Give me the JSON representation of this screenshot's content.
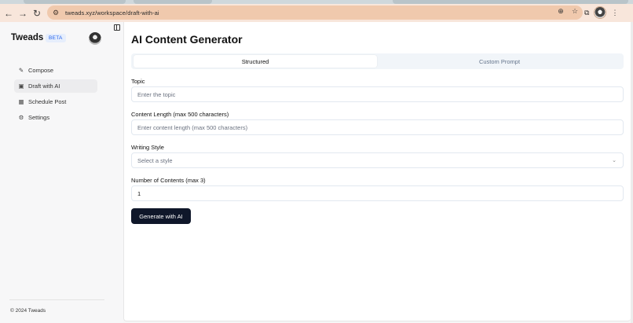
{
  "browser": {
    "url": "tweads.xyz/workspace/draft-with-ai",
    "back_icon": "arrow-left-icon",
    "forward_icon": "arrow-right-icon",
    "reload_icon": "reload-icon"
  },
  "sidebar": {
    "brand": "Tweads",
    "badge": "BETA",
    "items": [
      {
        "label": "Compose",
        "icon": "pencil-icon"
      },
      {
        "label": "Draft with AI",
        "icon": "bot-icon"
      },
      {
        "label": "Schedule Post",
        "icon": "calendar-icon"
      },
      {
        "label": "Settings",
        "icon": "gear-icon"
      }
    ],
    "active_index": 1,
    "footer": "© 2024 Tweads"
  },
  "main": {
    "title": "AI Content Generator",
    "tabs": [
      {
        "label": "Structured",
        "active": true
      },
      {
        "label": "Custom Prompt",
        "active": false
      }
    ],
    "fields": {
      "topic": {
        "label": "Topic",
        "placeholder": "Enter the topic",
        "value": ""
      },
      "length": {
        "label": "Content Length (max 500 characters)",
        "placeholder": "Enter content length (max 500 characters)",
        "value": ""
      },
      "style": {
        "label": "Writing Style",
        "placeholder": "Select a style",
        "value": ""
      },
      "count": {
        "label": "Number of Contents (max 3)",
        "value": "1"
      }
    },
    "generate_label": "Generate with AI"
  },
  "colors": {
    "primary_button": "#0f172a",
    "badge": "#2563eb",
    "toolbar": "#f8e6db",
    "omnibox": "#f0c9ad"
  }
}
